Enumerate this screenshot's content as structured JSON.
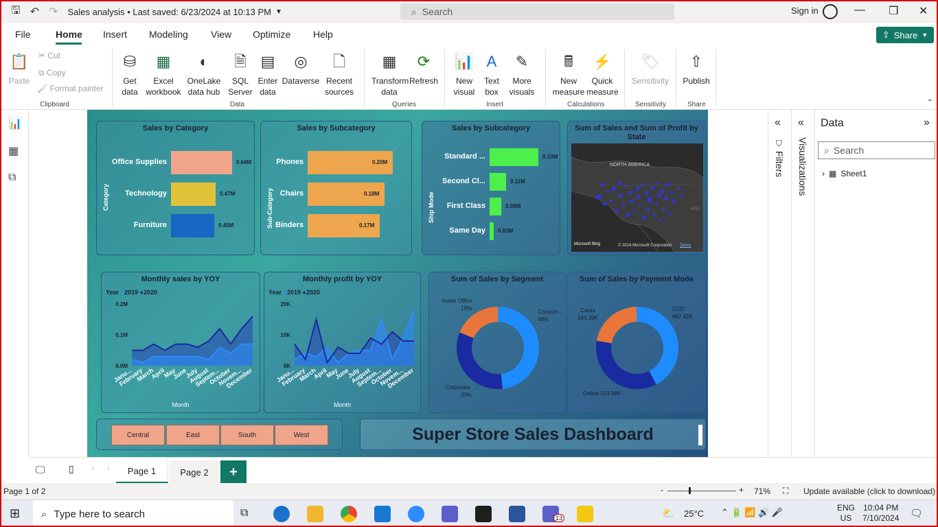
{
  "app": {
    "doc_title": "Sales analysis",
    "saved_text": "• Last saved: 6/23/2024 at 10:13 PM",
    "search_placeholder": "Search",
    "signin": "Sign in"
  },
  "menu": {
    "tabs": [
      "File",
      "Home",
      "Insert",
      "Modeling",
      "View",
      "Optimize",
      "Help"
    ],
    "active": "Home",
    "share": "Share"
  },
  "ribbon": {
    "clipboard": {
      "paste": "Paste",
      "cut": "Cut",
      "copy": "Copy",
      "format_painter": "Format painter",
      "group": "Clipboard"
    },
    "data": {
      "get_data": "Get data",
      "excel": "Excel workbook",
      "onelake": "OneLake data hub",
      "sql": "SQL Server",
      "enter": "Enter data",
      "dataverse": "Dataverse",
      "recent": "Recent sources",
      "group": "Data"
    },
    "queries": {
      "transform": "Transform data",
      "refresh": "Refresh",
      "group": "Queries"
    },
    "insert": {
      "new_visual": "New visual",
      "text_box": "Text box",
      "more_visuals": "More visuals",
      "group": "Insert"
    },
    "calculations": {
      "new_measure": "New measure",
      "quick_measure": "Quick measure",
      "group": "Calculations"
    },
    "sensitivity": {
      "label": "Sensitivity",
      "group": "Sensitivity"
    },
    "share": {
      "publish": "Publish",
      "group": "Share"
    }
  },
  "report": {
    "cat_card": {
      "title": "Sales by Category",
      "axis": "Category",
      "bars": [
        {
          "label": "Office Supplies",
          "value": "0.64M",
          "color": "#f0a58a",
          "v": 0.64
        },
        {
          "label": "Technology",
          "value": "0.47M",
          "color": "#e2c23a",
          "v": 0.47
        },
        {
          "label": "Furniture",
          "value": "0.45M",
          "color": "#1767c4",
          "v": 0.45
        }
      ]
    },
    "subcat_card": {
      "title": "Sales by Subcategory",
      "axis": "Sub-Category",
      "bars": [
        {
          "label": "Phones",
          "value": "0.20M",
          "color": "#eda64d",
          "v": 0.2
        },
        {
          "label": "Chairs",
          "value": "0.18M",
          "color": "#eda64d",
          "v": 0.18
        },
        {
          "label": "Binders",
          "value": "0.17M",
          "color": "#eda64d",
          "v": 0.17
        }
      ]
    },
    "ship_card": {
      "title": "Sales by Subcategory",
      "axis": "Ship Mode",
      "bars": [
        {
          "label": "Standard ...",
          "value": "0.33M",
          "color": "#4cef4c",
          "v": 0.33
        },
        {
          "label": "Second Cl...",
          "value": "0.11M",
          "color": "#4cef4c",
          "v": 0.11
        },
        {
          "label": "First Class",
          "value": "0.08M",
          "color": "#4cef4c",
          "v": 0.08
        },
        {
          "label": "Same Day",
          "value": "0.03M",
          "color": "#4cef4c",
          "v": 0.03
        }
      ]
    },
    "map_card": {
      "title": "Sum of Sales and Sum of Profit by State",
      "region": "NORTH AMERICA",
      "ocean": "Atla",
      "bing": "Microsoft Bing",
      "copyright": "© 2024 Microsoft Corporation",
      "terms": "Terms"
    },
    "sales_yoy": {
      "title": "Monthly sales by YOY",
      "legend_title": "Year",
      "y_ticks": [
        "0.2M",
        "0.1M",
        "0.0M"
      ],
      "xlabel": "Month"
    },
    "profit_yoy": {
      "title": "Monthly profit by YOY",
      "legend_title": "Year",
      "y_ticks": [
        "20K",
        "10K",
        "0K"
      ],
      "xlabel": "Month"
    },
    "month_labels": [
      "Janu...",
      "February",
      "March",
      "April",
      "May",
      "June",
      "July",
      "August",
      "Septem...",
      "October",
      "Novem...",
      "December"
    ],
    "segment": {
      "title": "Sum of Sales by Segment",
      "labels": [
        {
          "name": "Home Office",
          "pct": "19%"
        },
        {
          "name": "Consum...",
          "pct": "48%"
        },
        {
          "name": "Corporate",
          "pct": "33%"
        }
      ]
    },
    "payment": {
      "title": "Sum of Sales by Payment Mode",
      "labels": [
        {
          "name": "Cards",
          "val": "344.39K"
        },
        {
          "name": "COD",
          "val": "667.42K"
        },
        {
          "name": "Online",
          "val": "553.99K"
        }
      ]
    },
    "regions": [
      "Central",
      "East",
      "South",
      "West"
    ],
    "dashboard_title": "Super Store Sales Dashboard"
  },
  "chart_data": [
    {
      "type": "bar",
      "title": "Sales by Category",
      "ylabel": "Category",
      "categories": [
        "Office Supplies",
        "Technology",
        "Furniture"
      ],
      "values": [
        0.64,
        0.47,
        0.45
      ]
    },
    {
      "type": "bar",
      "title": "Sales by Subcategory",
      "ylabel": "Sub-Category",
      "categories": [
        "Phones",
        "Chairs",
        "Binders"
      ],
      "values": [
        0.2,
        0.18,
        0.17
      ]
    },
    {
      "type": "bar",
      "title": "Sales by Subcategory",
      "ylabel": "Ship Mode",
      "categories": [
        "Standard ...",
        "Second Cl...",
        "First Class",
        "Same Day"
      ],
      "values": [
        0.33,
        0.11,
        0.08,
        0.03
      ]
    },
    {
      "type": "area",
      "title": "Monthly sales by YOY",
      "xlabel": "Month",
      "ylim": [
        0,
        0.2
      ],
      "categories": [
        "Janu...",
        "February",
        "March",
        "April",
        "May",
        "June",
        "July",
        "August",
        "Septem...",
        "October",
        "Novem...",
        "December"
      ],
      "series": [
        {
          "name": "2019",
          "values": [
            0.02,
            0.01,
            0.03,
            0.03,
            0.03,
            0.03,
            0.03,
            0.02,
            0.06,
            0.04,
            0.07,
            0.07
          ]
        },
        {
          "name": "2020",
          "values": [
            0.05,
            0.05,
            0.07,
            0.05,
            0.07,
            0.07,
            0.06,
            0.08,
            0.12,
            0.07,
            0.12,
            0.16
          ]
        }
      ]
    },
    {
      "type": "area",
      "title": "Monthly profit by YOY",
      "xlabel": "Month",
      "ylim": [
        0,
        20
      ],
      "categories": [
        "Janu...",
        "February",
        "March",
        "April",
        "May",
        "June",
        "July",
        "August",
        "Septem...",
        "October",
        "Novem...",
        "December"
      ],
      "series": [
        {
          "name": "2019",
          "values": [
            2,
            4,
            3,
            6,
            1,
            4,
            5,
            5,
            15,
            2,
            9,
            18
          ]
        },
        {
          "name": "2020",
          "values": [
            7,
            2,
            15,
            1,
            6,
            4,
            4,
            9,
            7,
            11,
            8,
            8
          ]
        }
      ]
    },
    {
      "type": "pie",
      "title": "Sum of Sales by Segment",
      "categories": [
        "Home Office",
        "Consum...",
        "Corporate"
      ],
      "values": [
        19,
        48,
        33
      ]
    },
    {
      "type": "pie",
      "title": "Sum of Sales by Payment Mode",
      "categories": [
        "Cards",
        "COD",
        "Online"
      ],
      "values": [
        344.39,
        667.42,
        553.99
      ]
    }
  ],
  "right": {
    "filters": "Filters",
    "visualizations": "Visualizations",
    "data_title": "Data",
    "data_search": "Search",
    "table": "Sheet1"
  },
  "pages": {
    "tabs": [
      "Page 1",
      "Page 2"
    ],
    "add": "+"
  },
  "status": {
    "page_info": "Page 1 of 2",
    "zoom": "71%",
    "update": "Update available (click to download)"
  },
  "taskbar": {
    "search": "Type here to search",
    "weather": "25°C",
    "lang1": "ENG",
    "lang2": "US",
    "time": "10:04 PM",
    "date": "7/10/2024",
    "badge": "13"
  }
}
